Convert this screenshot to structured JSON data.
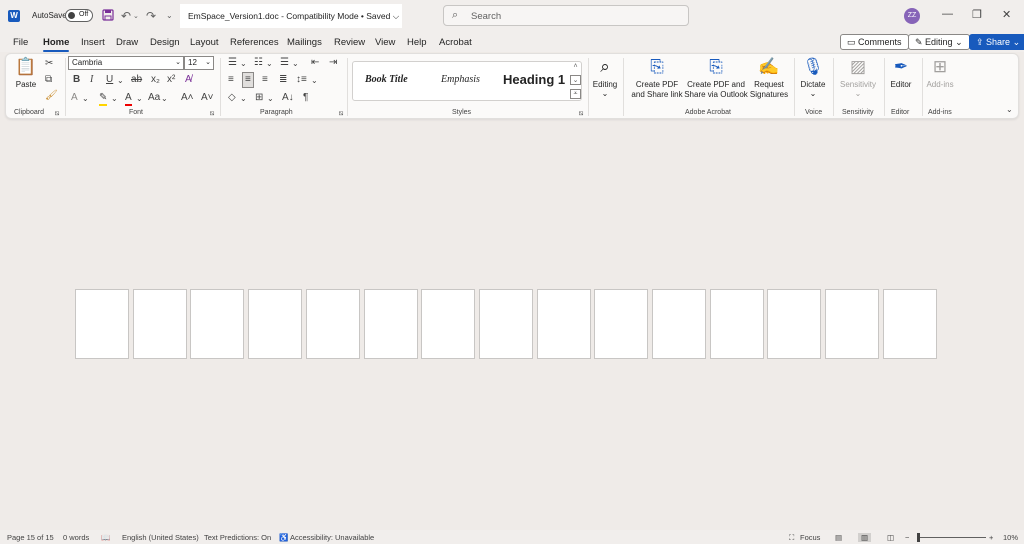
{
  "titlebar": {
    "app_logo": "W",
    "autosave_label": "AutoSave",
    "autosave_state": "Off",
    "doc_title": "EmSpace_Version1.doc  -  Compatibility Mode • Saved ⌵",
    "search_placeholder": "Search",
    "user_initials": "ZZ",
    "icons": [
      "save-icon",
      "undo-icon",
      "redo-icon",
      "customize-icon",
      "minimize-icon",
      "restore-icon",
      "close-icon"
    ]
  },
  "menu": {
    "tabs": [
      "File",
      "Home",
      "Insert",
      "Draw",
      "Design",
      "Layout",
      "References",
      "Mailings",
      "Review",
      "View",
      "Help",
      "Acrobat"
    ],
    "active_tab": "Home",
    "comments": "Comments",
    "editing": "Editing",
    "share": "Share"
  },
  "ribbon": {
    "clipboard": {
      "paste": "Paste",
      "label": "Clipboard"
    },
    "font": {
      "name": "Cambria",
      "size": "12",
      "label": "Font"
    },
    "paragraph": {
      "label": "Paragraph"
    },
    "styles": {
      "items": [
        "Book Title",
        "Emphasis",
        "Heading 1"
      ],
      "label": "Styles"
    },
    "editing_btn": "Editing",
    "acrobat": {
      "create_pdf_share": "Create PDF\nand Share link",
      "create_pdf_outlook": "Create PDF and\nShare via Outlook",
      "request_signatures": "Request\nSignatures",
      "label": "Adobe Acrobat"
    },
    "voice": {
      "dictate": "Dictate",
      "label": "Voice"
    },
    "sensitivity": {
      "btn": "Sensitivity",
      "label": "Sensitivity"
    },
    "editor": {
      "btn": "Editor",
      "label": "Editor"
    },
    "addins": {
      "btn": "Add-ins",
      "label": "Add-ins"
    }
  },
  "document": {
    "page_count": 15
  },
  "status": {
    "page": "Page 15 of 15",
    "words": "0 words",
    "language": "English (United States)",
    "predictions": "Text Predictions: On",
    "accessibility": "Accessibility: Unavailable",
    "focus": "Focus",
    "zoom": "10%",
    "zoom_level": 0.1
  },
  "colors": {
    "accent": "#185abd",
    "avatar": "#8764b8",
    "background": "#efebe8"
  }
}
